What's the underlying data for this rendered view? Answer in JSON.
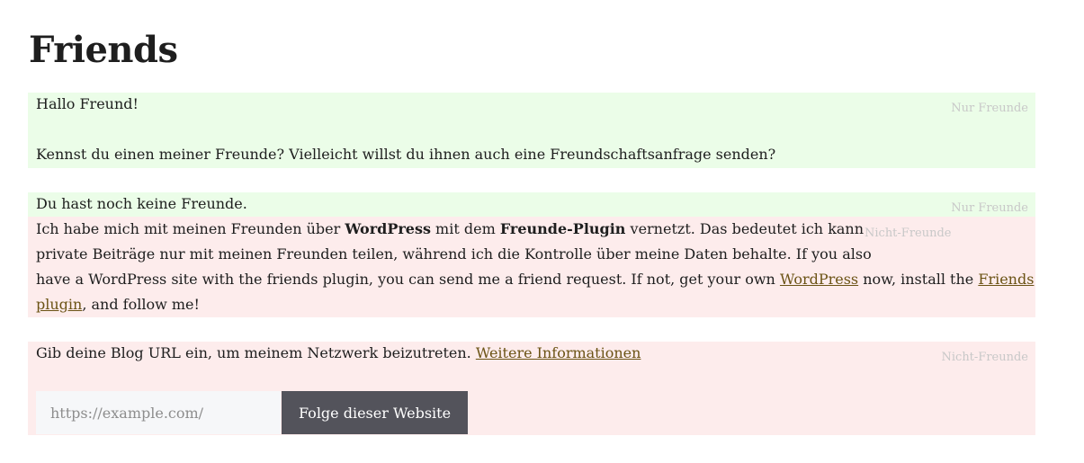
{
  "page": {
    "title": "Friends"
  },
  "friends_block": {
    "greeting": "Hallo Freund!",
    "question": "Kennst du einen meiner Freunde? Vielleicht willst du ihnen auch eine Freundschaftsanfrage senden?",
    "tag": "Nur Freunde"
  },
  "no_friends_block": {
    "text": "Du hast noch keine Freunde.",
    "tag": "Nur Freunde"
  },
  "info_block": {
    "tag": "Nicht-Freunde",
    "part1": "Ich habe mich mit meinen Freunden über ",
    "wordpress_bold": "WordPress",
    "part2": " mit dem ",
    "plugin_bold": "Freunde-Plugin",
    "part3": " vernetzt. Das bedeutet ich kann",
    "line2": "private Beiträge nur mit meinen Freunden teilen, während ich die Kontrolle über meine Daten behalte. If you also",
    "line3_part1": "have a WordPress site with the friends plugin, you can send me a friend request. If not, get your own ",
    "wordpress_link": "WordPress",
    "line3_part2": " now, install the ",
    "friends_link_part1": "Friends",
    "friends_link_part2": "plugin",
    "line4_rest": ", and follow me!"
  },
  "join_block": {
    "tag": "Nicht-Freunde",
    "text": "Gib deine Blog URL ein, um meinem Netzwerk beizutreten. ",
    "more_link": "Weitere Informationen",
    "url_placeholder": "https://example.com/",
    "follow_button": "Folge dieser Website"
  },
  "colors": {
    "friends_bg": "#ebfde8",
    "non_friends_bg": "#fdecec",
    "link": "#6b5315",
    "button_bg": "#53535b"
  }
}
